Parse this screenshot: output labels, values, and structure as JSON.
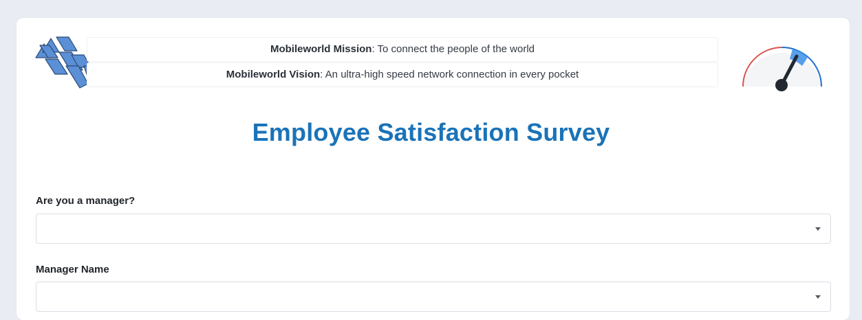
{
  "header": {
    "logo_icon": "mobileworld-logo-icon",
    "gauge_icon": "speedometer-gauge-icon",
    "mission_label": "Mobileworld Mission",
    "mission_text": ": To connect the people of the world",
    "vision_label": "Mobileworld Vision",
    "vision_text": ": An ultra-high speed network connection in every pocket"
  },
  "main": {
    "title": "Employee Satisfaction Survey",
    "fields": [
      {
        "label": "Are you a manager?",
        "value": ""
      },
      {
        "label": "Manager Name",
        "value": ""
      }
    ]
  },
  "colors": {
    "accent": "#1a73b8",
    "logo_blue": "#5b8fd6",
    "gauge_red": "#d9534f",
    "gauge_blue": "#1f6fd1"
  }
}
